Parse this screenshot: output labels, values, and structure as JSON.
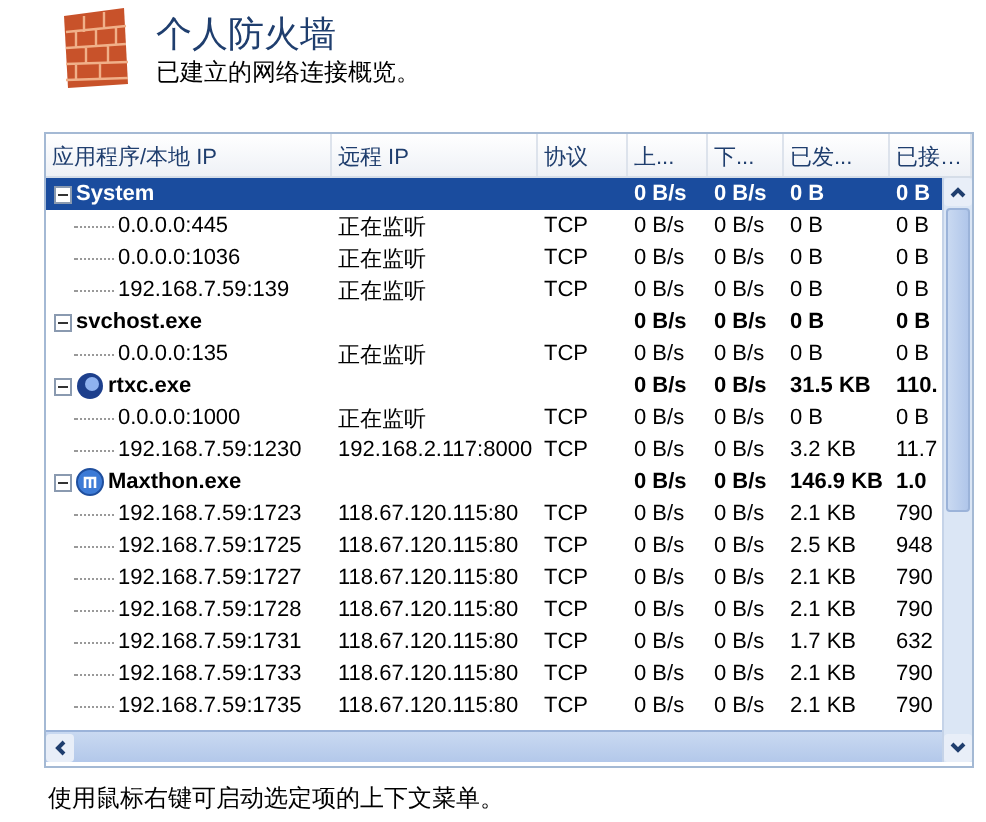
{
  "header": {
    "title": "个人防火墙",
    "subtitle": "已建立的网络连接概览。"
  },
  "table": {
    "columns": [
      "应用程序/本地 IP",
      "远程 IP",
      "协议",
      "上...",
      "下...",
      "已发...",
      "已接…"
    ],
    "groups": [
      {
        "name": "System",
        "expanded": true,
        "selected": true,
        "up": "0 B/s",
        "down": "0 B/s",
        "sent": "0 B",
        "received": "0 B",
        "children": [
          {
            "local": "0.0.0.0:445",
            "remote": "正在监听",
            "protocol": "TCP",
            "up": "0 B/s",
            "down": "0 B/s",
            "sent": "0 B",
            "received": "0 B"
          },
          {
            "local": "0.0.0.0:1036",
            "remote": "正在监听",
            "protocol": "TCP",
            "up": "0 B/s",
            "down": "0 B/s",
            "sent": "0 B",
            "received": "0 B"
          },
          {
            "local": "192.168.7.59:139",
            "remote": "正在监听",
            "protocol": "TCP",
            "up": "0 B/s",
            "down": "0 B/s",
            "sent": "0 B",
            "received": "0 B"
          }
        ]
      },
      {
        "name": "svchost.exe",
        "expanded": true,
        "selected": false,
        "up": "0 B/s",
        "down": "0 B/s",
        "sent": "0 B",
        "received": "0 B",
        "children": [
          {
            "local": "0.0.0.0:135",
            "remote": "正在监听",
            "protocol": "TCP",
            "up": "0 B/s",
            "down": "0 B/s",
            "sent": "0 B",
            "received": "0 B"
          }
        ]
      },
      {
        "name": "rtxc.exe",
        "expanded": true,
        "selected": false,
        "up": "0 B/s",
        "down": "0 B/s",
        "sent": "31.5 KB",
        "received": "110.",
        "children": [
          {
            "local": "0.0.0.0:1000",
            "remote": "正在监听",
            "protocol": "TCP",
            "up": "0 B/s",
            "down": "0 B/s",
            "sent": "0 B",
            "received": "0 B"
          },
          {
            "local": "192.168.7.59:1230",
            "remote": "192.168.2.117:8000",
            "protocol": "TCP",
            "up": "0 B/s",
            "down": "0 B/s",
            "sent": "3.2 KB",
            "received": "11.7"
          }
        ]
      },
      {
        "name": "Maxthon.exe",
        "expanded": true,
        "selected": false,
        "up": "0 B/s",
        "down": "0 B/s",
        "sent": "146.9 KB",
        "received": "1.0",
        "children": [
          {
            "local": "192.168.7.59:1723",
            "remote": "118.67.120.115:80",
            "protocol": "TCP",
            "up": "0 B/s",
            "down": "0 B/s",
            "sent": "2.1 KB",
            "received": "790"
          },
          {
            "local": "192.168.7.59:1725",
            "remote": "118.67.120.115:80",
            "protocol": "TCP",
            "up": "0 B/s",
            "down": "0 B/s",
            "sent": "2.5 KB",
            "received": "948"
          },
          {
            "local": "192.168.7.59:1727",
            "remote": "118.67.120.115:80",
            "protocol": "TCP",
            "up": "0 B/s",
            "down": "0 B/s",
            "sent": "2.1 KB",
            "received": "790"
          },
          {
            "local": "192.168.7.59:1728",
            "remote": "118.67.120.115:80",
            "protocol": "TCP",
            "up": "0 B/s",
            "down": "0 B/s",
            "sent": "2.1 KB",
            "received": "790"
          },
          {
            "local": "192.168.7.59:1731",
            "remote": "118.67.120.115:80",
            "protocol": "TCP",
            "up": "0 B/s",
            "down": "0 B/s",
            "sent": "1.7 KB",
            "received": "632"
          },
          {
            "local": "192.168.7.59:1733",
            "remote": "118.67.120.115:80",
            "protocol": "TCP",
            "up": "0 B/s",
            "down": "0 B/s",
            "sent": "2.1 KB",
            "received": "790"
          },
          {
            "local": "192.168.7.59:1735",
            "remote": "118.67.120.115:80",
            "protocol": "TCP",
            "up": "0 B/s",
            "down": "0 B/s",
            "sent": "2.1 KB",
            "received": "790"
          }
        ]
      }
    ]
  },
  "footer": "使用鼠标右键可启动选定项的上下文菜单。"
}
